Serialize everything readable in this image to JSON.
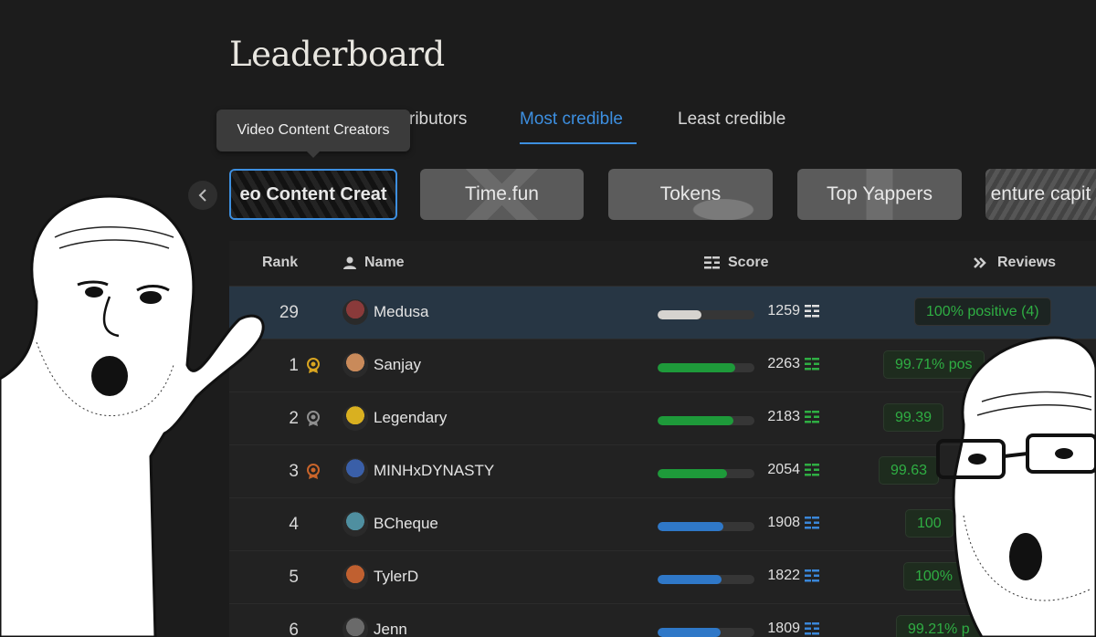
{
  "page": {
    "title": "Leaderboard"
  },
  "tabs": [
    {
      "label": "ributors",
      "active": false
    },
    {
      "label": "Most credible",
      "active": true
    },
    {
      "label": "Least credible",
      "active": false
    }
  ],
  "tooltip": "Video Content Creators",
  "categories": [
    "eo Content Creat",
    "Time.fun",
    "Tokens",
    "Top Yappers",
    "enture capit"
  ],
  "table": {
    "headers": {
      "rank": "Rank",
      "name": "Name",
      "score": "Score",
      "reviews": "Reviews"
    },
    "rows": [
      {
        "rank": "29",
        "name": "Medusa",
        "score": "1259",
        "review": "100% positive (4)",
        "fill": 0.45,
        "bar_color": "#d6d3cf",
        "medal": "none"
      },
      {
        "rank": "1",
        "name": "Sanjay",
        "score": "2263",
        "review": "99.71% pos",
        "fill": 0.8,
        "bar_color": "#1e9a3a",
        "medal": "gold"
      },
      {
        "rank": "2",
        "name": "Legendary",
        "score": "2183",
        "review": "99.39",
        "fill": 0.78,
        "bar_color": "#1e9a3a",
        "medal": "silver"
      },
      {
        "rank": "3",
        "name": "MINHxDYNASTY",
        "score": "2054",
        "review": "99.63",
        "fill": 0.72,
        "bar_color": "#1e9a3a",
        "medal": "bronze"
      },
      {
        "rank": "4",
        "name": "BCheque",
        "score": "1908",
        "review": "100",
        "fill": 0.68,
        "bar_color": "#2f78c8",
        "medal": "none"
      },
      {
        "rank": "5",
        "name": "TylerD",
        "score": "1822",
        "review": "100%",
        "fill": 0.66,
        "bar_color": "#2f78c8",
        "medal": "none"
      },
      {
        "rank": "6",
        "name": "Jenn",
        "score": "1809",
        "review": "99.21% p",
        "fill": 0.65,
        "bar_color": "#2f78c8",
        "medal": "none"
      }
    ]
  },
  "colors": {
    "accent": "#3d8fe0",
    "positive": "#2fae43",
    "highlight_row": "#273644"
  }
}
